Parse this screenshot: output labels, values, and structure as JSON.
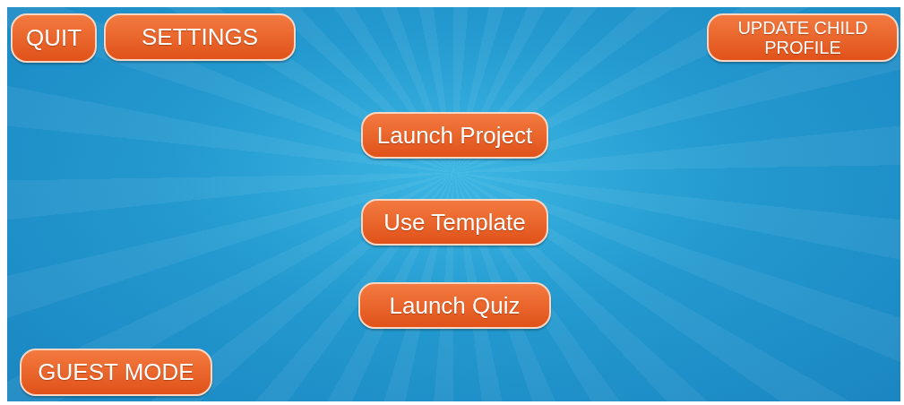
{
  "top_left_buttons": [
    "QUIT",
    "SETTINGS"
  ],
  "top_right_button": "UPDATE CHILD PROFILE",
  "center_buttons": [
    "Launch Project",
    "Use Template",
    "Launch Quiz"
  ],
  "bottom_button": "GUEST MODE"
}
